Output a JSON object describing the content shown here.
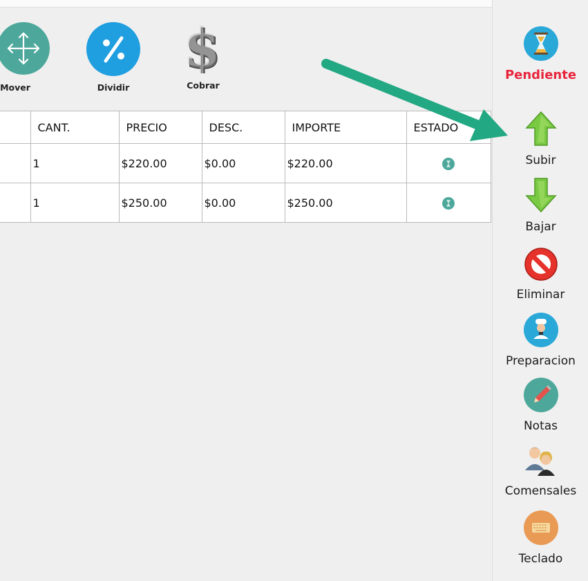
{
  "toolbar": {
    "mover_label": "Mover",
    "dividir_label": "Dividir",
    "cobrar_label": "Cobrar"
  },
  "table": {
    "columns": [
      "",
      "CANT.",
      "PRECIO",
      "DESC.",
      "IMPORTE",
      "ESTADO"
    ],
    "rows": [
      {
        "cant": "1",
        "precio": "$220.00",
        "desc": "$0.00",
        "importe": "$220.00",
        "estado_icon": "hourglass-icon"
      },
      {
        "cant": "1",
        "precio": "$250.00",
        "desc": "$0.00",
        "importe": "$250.00",
        "estado_icon": "hourglass-icon"
      }
    ]
  },
  "sidebar": {
    "status_label": "Pendiente",
    "items": [
      {
        "label": "Subir",
        "icon": "arrow-up-icon"
      },
      {
        "label": "Bajar",
        "icon": "arrow-down-icon"
      },
      {
        "label": "Eliminar",
        "icon": "forbidden-icon"
      },
      {
        "label": "Preparacion",
        "icon": "chef-icon"
      },
      {
        "label": "Notas",
        "icon": "pencil-icon"
      },
      {
        "label": "Comensales",
        "icon": "people-icon"
      },
      {
        "label": "Teclado",
        "icon": "keyboard-icon"
      }
    ]
  },
  "colors": {
    "pendiente": "#e8243b",
    "teal": "#4da89b",
    "blue": "#1f9ee0",
    "green_arrow": "#22a882"
  }
}
